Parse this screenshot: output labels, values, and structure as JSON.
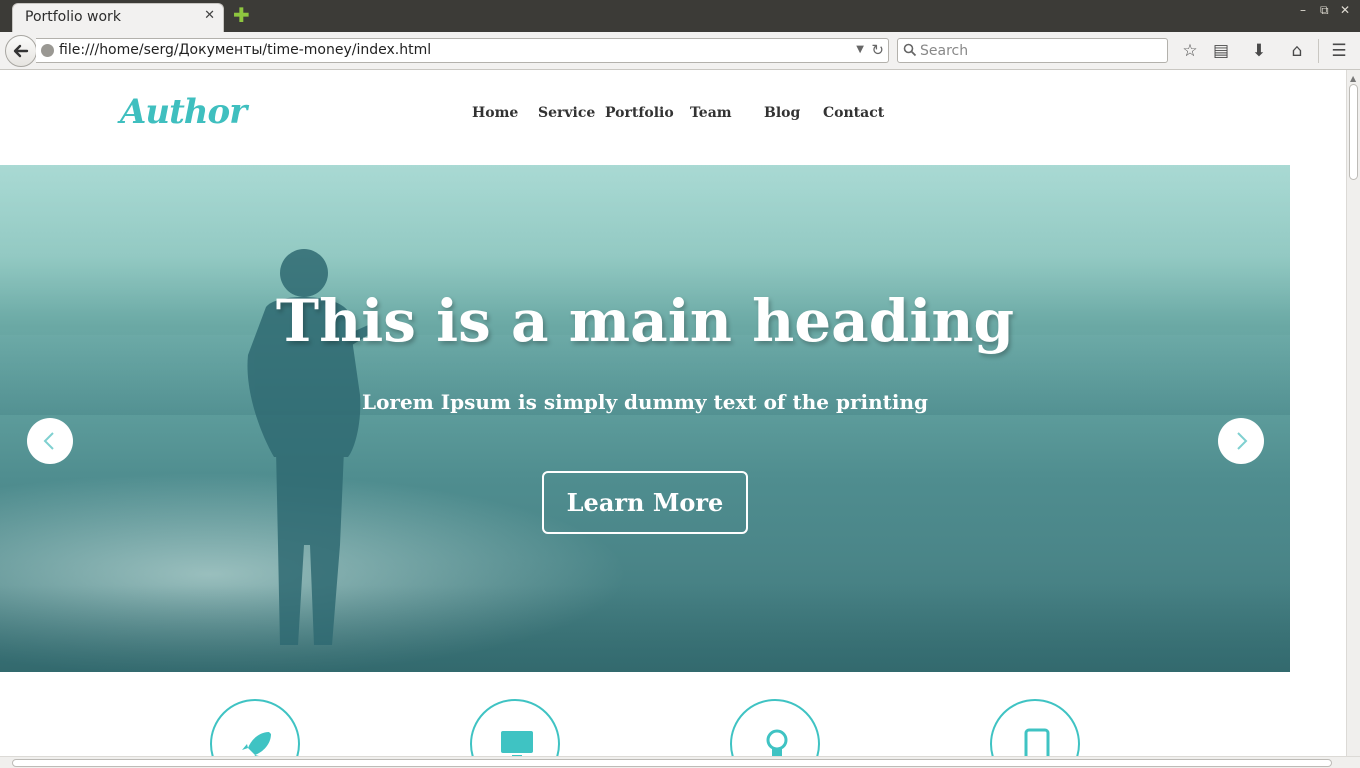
{
  "browser": {
    "tab_title": "Portfolio work",
    "tab_close": "✕",
    "url": "file:///home/serg/Документы/time-money/index.html",
    "search_placeholder": "Search",
    "window_controls": [
      "–",
      "⧉",
      "✕"
    ]
  },
  "site": {
    "logo": "Author",
    "brand_color": "#3fbfbf",
    "nav": [
      {
        "label": "Home"
      },
      {
        "label": "Service"
      },
      {
        "label": "Portfolio"
      },
      {
        "label": "Team"
      },
      {
        "label": "Blog"
      },
      {
        "label": "Contact"
      }
    ]
  },
  "hero": {
    "heading": "This is a main heading",
    "subheading": "Lorem Ipsum is simply dummy text of the printing",
    "cta_label": "Learn More",
    "overlay_color": "#5fb3ad"
  },
  "features": {
    "icons": [
      "rocket-icon",
      "monitor-icon",
      "lightbulb-icon",
      "tablet-icon"
    ],
    "accent": "#3fc3c3"
  }
}
